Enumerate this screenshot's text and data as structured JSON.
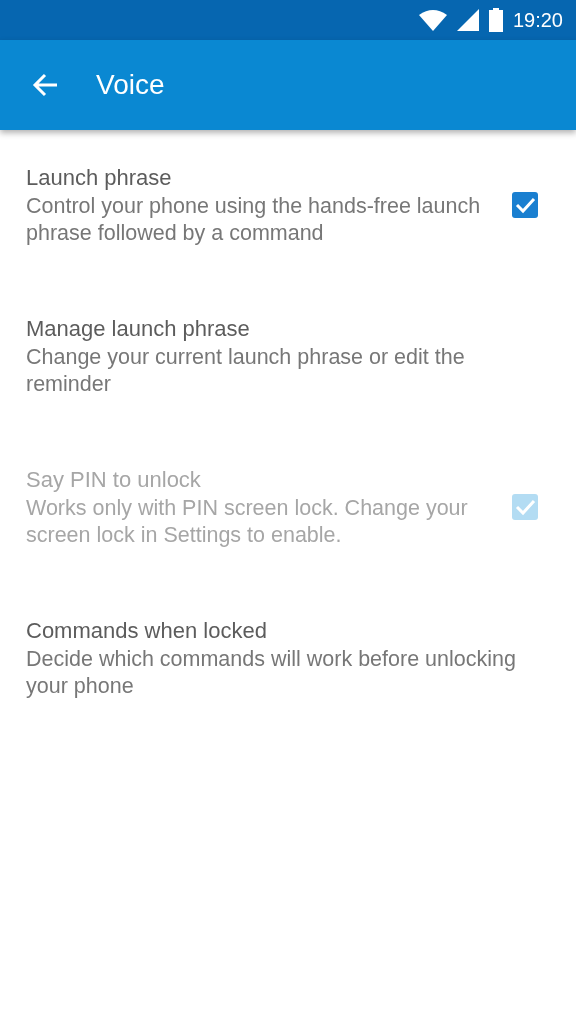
{
  "status_bar": {
    "time": "19:20"
  },
  "app_bar": {
    "title": "Voice"
  },
  "settings": [
    {
      "title": "Launch phrase",
      "summary": "Control your phone using the hands-free launch phrase followed by a command",
      "kind": "checkbox",
      "checked": true,
      "disabled": false
    },
    {
      "title": "Manage launch phrase",
      "summary": "Change your current launch phrase or edit the reminder",
      "kind": "plain",
      "disabled": false
    },
    {
      "title": "Say PIN to unlock",
      "summary": "Works only with PIN screen lock. Change your screen lock in Settings to enable.",
      "kind": "checkbox",
      "checked": true,
      "disabled": true
    },
    {
      "title": "Commands when locked",
      "summary": "Decide which commands will work before unlocking your phone",
      "kind": "plain",
      "disabled": false
    }
  ]
}
